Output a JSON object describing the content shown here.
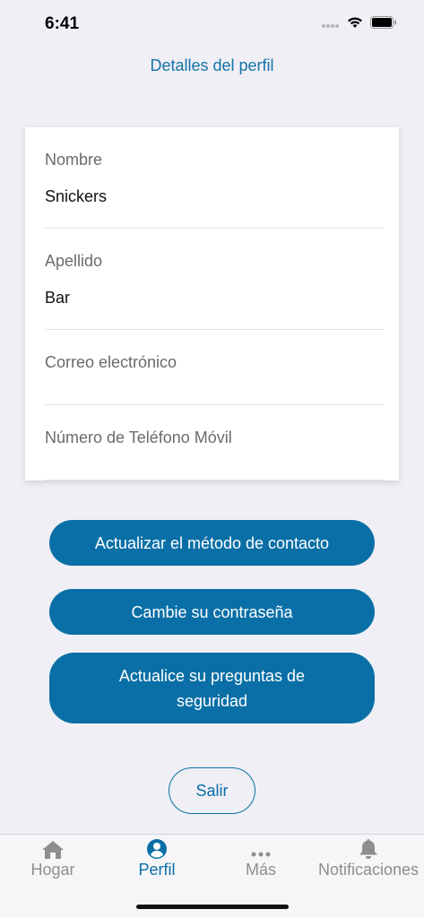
{
  "status": {
    "time": "6:41"
  },
  "header": {
    "title": "Detalles del perfil"
  },
  "profile": {
    "fields": [
      {
        "label": "Nombre",
        "value": "Snickers"
      },
      {
        "label": "Apellido",
        "value": "Bar"
      },
      {
        "label": "Correo electrónico",
        "value": ""
      },
      {
        "label": "Número de Teléfono Móvil",
        "value": ""
      }
    ]
  },
  "actions": {
    "update_contact": "Actualizar el método de contacto",
    "change_password": "Cambie su contraseña",
    "update_security": "Actualice su preguntas de seguridad",
    "logout": "Salir"
  },
  "tabbar": {
    "items": [
      {
        "label": "Hogar",
        "icon": "home-icon",
        "active": false
      },
      {
        "label": "Perfil",
        "icon": "profile-icon",
        "active": true
      },
      {
        "label": "Más",
        "icon": "more-icon",
        "active": false
      },
      {
        "label": "Notificaciones",
        "icon": "bell-icon",
        "active": false
      }
    ]
  },
  "colors": {
    "accent": "#0a6fa6",
    "background": "#f0eff5"
  }
}
